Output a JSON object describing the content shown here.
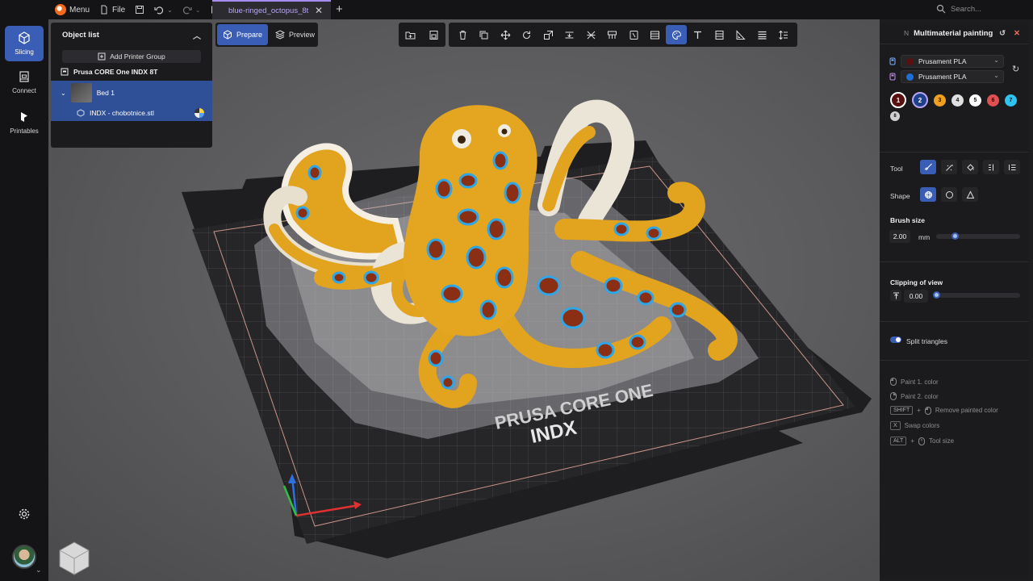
{
  "topbar": {
    "menu_label": "Menu",
    "file_label": "File",
    "tab_title": "blue-ringed_octopus_8t",
    "search_placeholder": "Search..."
  },
  "sidebar": {
    "items": [
      {
        "label": "Slicing",
        "icon": "cube-icon"
      },
      {
        "label": "Connect",
        "icon": "printer-icon"
      },
      {
        "label": "Printables",
        "icon": "printables-icon"
      }
    ]
  },
  "object_list": {
    "title": "Object list",
    "add_group_label": "Add Printer Group",
    "printer_name": "Prusa CORE One INDX 8T",
    "bed_label": "Bed 1",
    "file_name": "INDX - chobotnice.stl"
  },
  "mode": {
    "prepare_label": "Prepare",
    "preview_label": "Preview"
  },
  "viewport": {
    "bed_brand": "PRUSA CORE ONE",
    "bed_sub": "INDX"
  },
  "panel": {
    "shortcut": "N",
    "title": "Multimaterial painting",
    "filaments": [
      {
        "name": "Prusament PLA",
        "color": "#5a1010",
        "slot_color": "#7fb0ff"
      },
      {
        "name": "Prusament PLA",
        "color": "#1e6fd6",
        "slot_color": "#c38cf0"
      }
    ],
    "swatches": [
      {
        "n": "1",
        "color": "#5a1010",
        "ring": true
      },
      {
        "n": "2",
        "color": "#1e3f8a",
        "ring": true
      },
      {
        "n": "3",
        "color": "#f0a020"
      },
      {
        "n": "4",
        "color": "#e0e0e0"
      },
      {
        "n": "5",
        "color": "#ffffff"
      },
      {
        "n": "6",
        "color": "#e05050"
      },
      {
        "n": "7",
        "color": "#2ec3f0"
      },
      {
        "n": "8",
        "color": "#d0d0d0"
      }
    ],
    "tool_label": "Tool",
    "shape_label": "Shape",
    "brush_size_label": "Brush size",
    "brush_size_value": "2.00",
    "brush_unit": "mm",
    "brush_level": 0.2,
    "clipping_label": "Clipping of view",
    "clipping_value": "0.00",
    "split_label": "Split triangles",
    "hints": {
      "paint1": "Paint 1. color",
      "paint2": "Paint 2. color",
      "shift_key": "SHIFT",
      "remove": "Remove painted color",
      "x_key": "X",
      "swap": "Swap colors",
      "alt_key": "ALT",
      "toolsize": "Tool size",
      "plus": "+"
    }
  }
}
